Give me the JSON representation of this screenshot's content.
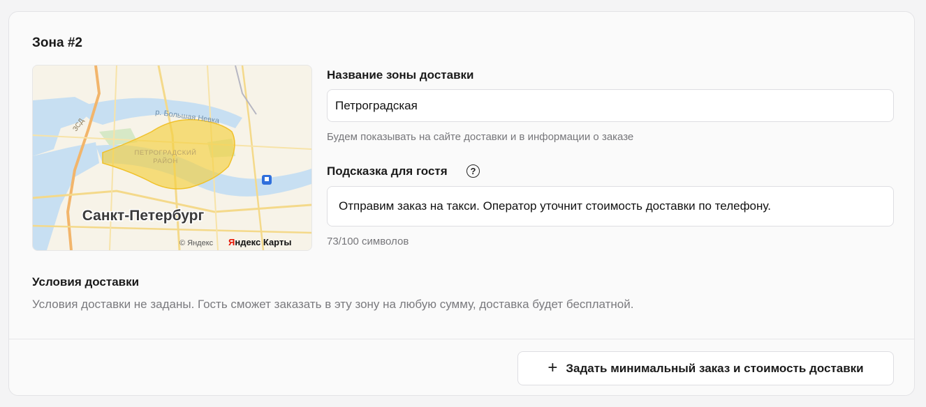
{
  "zone": {
    "title": "Зона #2"
  },
  "map": {
    "city_label": "Санкт-Петербург",
    "district_label_line1": "ПЕТРОГРАДСКИЙ",
    "district_label_line2": "РАЙОН",
    "river_label": "р. Большая Невка",
    "road_label": "ЗСД",
    "copyright": "© Яндекс",
    "brand_red": "Я",
    "brand_rest": "ндекс Карты",
    "zone_color": "#f5cf3f"
  },
  "name_field": {
    "label": "Название зоны доставки",
    "value": "Петроградская",
    "hint": "Будем показывать на сайте доставки и в информации о заказе"
  },
  "guest_hint": {
    "label": "Подсказка для гостя",
    "help_icon": "question-circle-icon",
    "help_glyph": "?",
    "value": "Отправим заказ на такси. Оператор уточнит стоимость доставки по телефону.",
    "counter": "73/100 символов"
  },
  "conditions": {
    "title": "Условия доставки",
    "text": "Условия доставки не заданы. Гость сможет заказать в эту зону на любую сумму, доставка будет бесплатной."
  },
  "action": {
    "plus_icon": "plus-icon",
    "plus_glyph": "+",
    "label": "Задать минимальный заказ и стоимость доставки"
  }
}
